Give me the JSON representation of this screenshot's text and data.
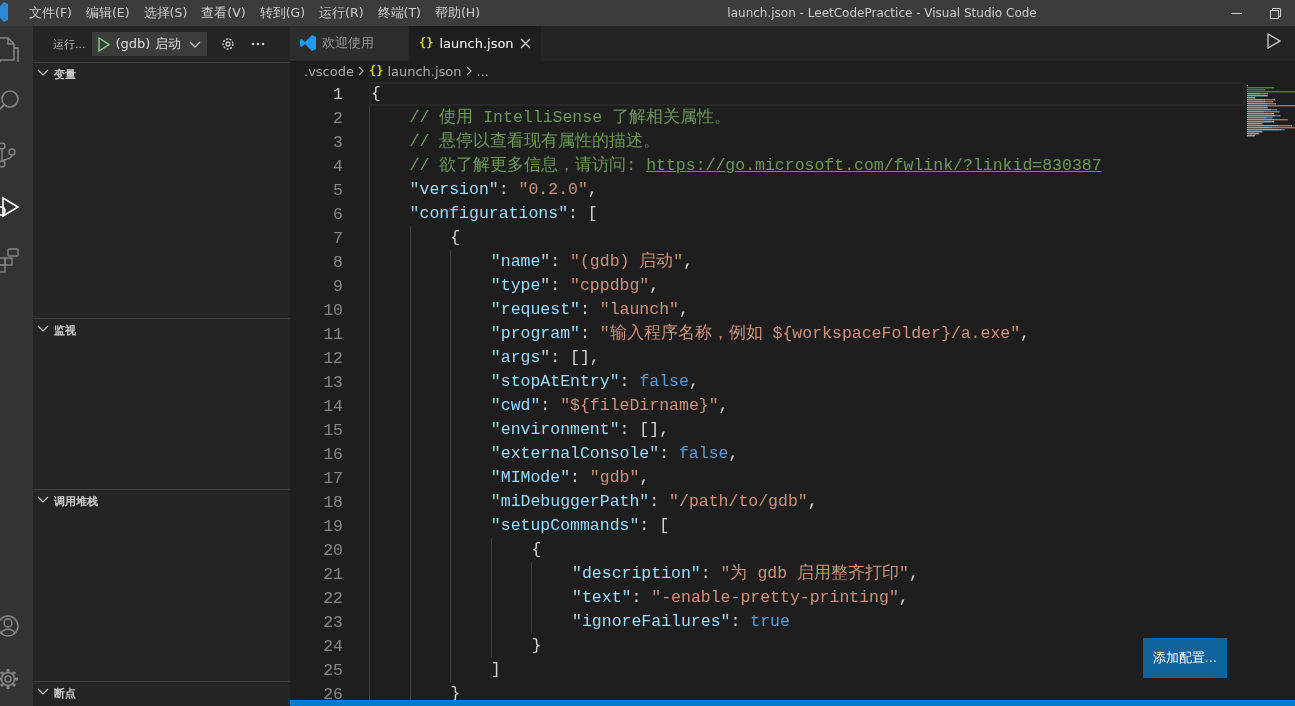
{
  "window": {
    "title": "launch.json - LeetCodePractice - Visual Studio Code"
  },
  "menu": [
    "文件(F)",
    "编辑(E)",
    "选择(S)",
    "查看(V)",
    "转到(G)",
    "运行(R)",
    "终端(T)",
    "帮助(H)"
  ],
  "activity_bar": [
    {
      "kind": "files",
      "selected": false
    },
    {
      "kind": "search",
      "selected": false
    },
    {
      "kind": "scm",
      "selected": false
    },
    {
      "kind": "run",
      "selected": true
    },
    {
      "kind": "extensions",
      "selected": false
    },
    {
      "kind": "account",
      "selected": false
    },
    {
      "kind": "settings",
      "selected": false
    }
  ],
  "sidebar": {
    "title": "运行...",
    "configuration": "(gdb) 启动",
    "sections": [
      {
        "label": "变量",
        "expanded": true
      },
      {
        "label": "监视",
        "expanded": true
      },
      {
        "label": "调用堆栈",
        "expanded": true
      },
      {
        "label": "断点",
        "expanded": true
      }
    ]
  },
  "tabs": [
    {
      "label": "欢迎使用",
      "kind": "welcome",
      "selected": false
    },
    {
      "label": "launch.json",
      "kind": "json",
      "icon": "{}",
      "selected": true
    }
  ],
  "breadcrumb": [
    {
      "text": ".vscode"
    },
    {
      "text": "launch.json",
      "kind": "json",
      "icon": "{}"
    },
    {
      "text": "..."
    }
  ],
  "code": [
    {
      "number": "1",
      "current": true,
      "tokens": [
        {
          "kind": "punct",
          "text": "{"
        }
      ]
    },
    {
      "number": "2",
      "current": false,
      "tokens": [
        {
          "kind": "comment",
          "text": "    // 使用 IntelliSense 了解相关属性。"
        }
      ]
    },
    {
      "number": "3",
      "current": false,
      "tokens": [
        {
          "kind": "comment",
          "text": "    // 悬停以查看现有属性的描述。"
        }
      ]
    },
    {
      "number": "4",
      "current": false,
      "tokens": [
        {
          "kind": "comment",
          "text": "    // 欲了解更多信息，请访问: "
        },
        {
          "kind": "link",
          "text": "https://go.microsoft.com/fwlink/?linkid=830387"
        }
      ]
    },
    {
      "number": "5",
      "current": false,
      "tokens": [
        {
          "kind": "key",
          "text": "    \"version\""
        },
        {
          "kind": "punct",
          "text": ": "
        },
        {
          "kind": "string",
          "text": "\"0.2.0\""
        },
        {
          "kind": "punct",
          "text": ","
        }
      ]
    },
    {
      "number": "6",
      "current": false,
      "tokens": [
        {
          "kind": "key",
          "text": "    \"configurations\""
        },
        {
          "kind": "punct",
          "text": ": ["
        }
      ]
    },
    {
      "number": "7",
      "current": false,
      "tokens": [
        {
          "kind": "punct",
          "text": "        {"
        }
      ]
    },
    {
      "number": "8",
      "current": false,
      "tokens": [
        {
          "kind": "key",
          "text": "            \"name\""
        },
        {
          "kind": "punct",
          "text": ": "
        },
        {
          "kind": "string",
          "text": "\"(gdb) 启动\""
        },
        {
          "kind": "punct",
          "text": ","
        }
      ]
    },
    {
      "number": "9",
      "current": false,
      "tokens": [
        {
          "kind": "key",
          "text": "            \"type\""
        },
        {
          "kind": "punct",
          "text": ": "
        },
        {
          "kind": "string",
          "text": "\"cppdbg\""
        },
        {
          "kind": "punct",
          "text": ","
        }
      ]
    },
    {
      "number": "10",
      "current": false,
      "tokens": [
        {
          "kind": "key",
          "text": "            \"request\""
        },
        {
          "kind": "punct",
          "text": ": "
        },
        {
          "kind": "string",
          "text": "\"launch\""
        },
        {
          "kind": "punct",
          "text": ","
        }
      ]
    },
    {
      "number": "11",
      "current": false,
      "tokens": [
        {
          "kind": "key",
          "text": "            \"program\""
        },
        {
          "kind": "punct",
          "text": ": "
        },
        {
          "kind": "string",
          "text": "\"输入程序名称，例如 ${workspaceFolder}/a.exe\""
        },
        {
          "kind": "punct",
          "text": ","
        }
      ]
    },
    {
      "number": "12",
      "current": false,
      "tokens": [
        {
          "kind": "key",
          "text": "            \"args\""
        },
        {
          "kind": "punct",
          "text": ": [],"
        }
      ]
    },
    {
      "number": "13",
      "current": false,
      "tokens": [
        {
          "kind": "key",
          "text": "            \"stopAtEntry\""
        },
        {
          "kind": "punct",
          "text": ": "
        },
        {
          "kind": "bool",
          "text": "false"
        },
        {
          "kind": "punct",
          "text": ","
        }
      ]
    },
    {
      "number": "14",
      "current": false,
      "tokens": [
        {
          "kind": "key",
          "text": "            \"cwd\""
        },
        {
          "kind": "punct",
          "text": ": "
        },
        {
          "kind": "string",
          "text": "\"${fileDirname}\""
        },
        {
          "kind": "punct",
          "text": ","
        }
      ]
    },
    {
      "number": "15",
      "current": false,
      "tokens": [
        {
          "kind": "key",
          "text": "            \"environment\""
        },
        {
          "kind": "punct",
          "text": ": [],"
        }
      ]
    },
    {
      "number": "16",
      "current": false,
      "tokens": [
        {
          "kind": "key",
          "text": "            \"externalConsole\""
        },
        {
          "kind": "punct",
          "text": ": "
        },
        {
          "kind": "bool",
          "text": "false"
        },
        {
          "kind": "punct",
          "text": ","
        }
      ]
    },
    {
      "number": "17",
      "current": false,
      "tokens": [
        {
          "kind": "key",
          "text": "            \"MIMode\""
        },
        {
          "kind": "punct",
          "text": ": "
        },
        {
          "kind": "string",
          "text": "\"gdb\""
        },
        {
          "kind": "punct",
          "text": ","
        }
      ]
    },
    {
      "number": "18",
      "current": false,
      "tokens": [
        {
          "kind": "key",
          "text": "            \"miDebuggerPath\""
        },
        {
          "kind": "punct",
          "text": ": "
        },
        {
          "kind": "string",
          "text": "\"/path/to/gdb\""
        },
        {
          "kind": "punct",
          "text": ","
        }
      ]
    },
    {
      "number": "19",
      "current": false,
      "tokens": [
        {
          "kind": "key",
          "text": "            \"setupCommands\""
        },
        {
          "kind": "punct",
          "text": ": ["
        }
      ]
    },
    {
      "number": "20",
      "current": false,
      "tokens": [
        {
          "kind": "punct",
          "text": "                {"
        }
      ]
    },
    {
      "number": "21",
      "current": false,
      "tokens": [
        {
          "kind": "key",
          "text": "                    \"description\""
        },
        {
          "kind": "punct",
          "text": ": "
        },
        {
          "kind": "string",
          "text": "\"为 gdb 启用整齐打印\""
        },
        {
          "kind": "punct",
          "text": ","
        }
      ]
    },
    {
      "number": "22",
      "current": false,
      "tokens": [
        {
          "kind": "key",
          "text": "                    \"text\""
        },
        {
          "kind": "punct",
          "text": ": "
        },
        {
          "kind": "string",
          "text": "\"-enable-pretty-printing\""
        },
        {
          "kind": "punct",
          "text": ","
        }
      ]
    },
    {
      "number": "23",
      "current": false,
      "tokens": [
        {
          "kind": "key",
          "text": "                    \"ignoreFailures\""
        },
        {
          "kind": "punct",
          "text": ": "
        },
        {
          "kind": "bool",
          "text": "true"
        }
      ]
    },
    {
      "number": "24",
      "current": false,
      "tokens": [
        {
          "kind": "punct",
          "text": "                }"
        }
      ]
    },
    {
      "number": "25",
      "current": false,
      "tokens": [
        {
          "kind": "punct",
          "text": "            ]"
        }
      ]
    },
    {
      "number": "26",
      "current": false,
      "tokens": [
        {
          "kind": "punct",
          "text": "        }"
        }
      ]
    }
  ],
  "add_configuration_button": "添加配置..."
}
